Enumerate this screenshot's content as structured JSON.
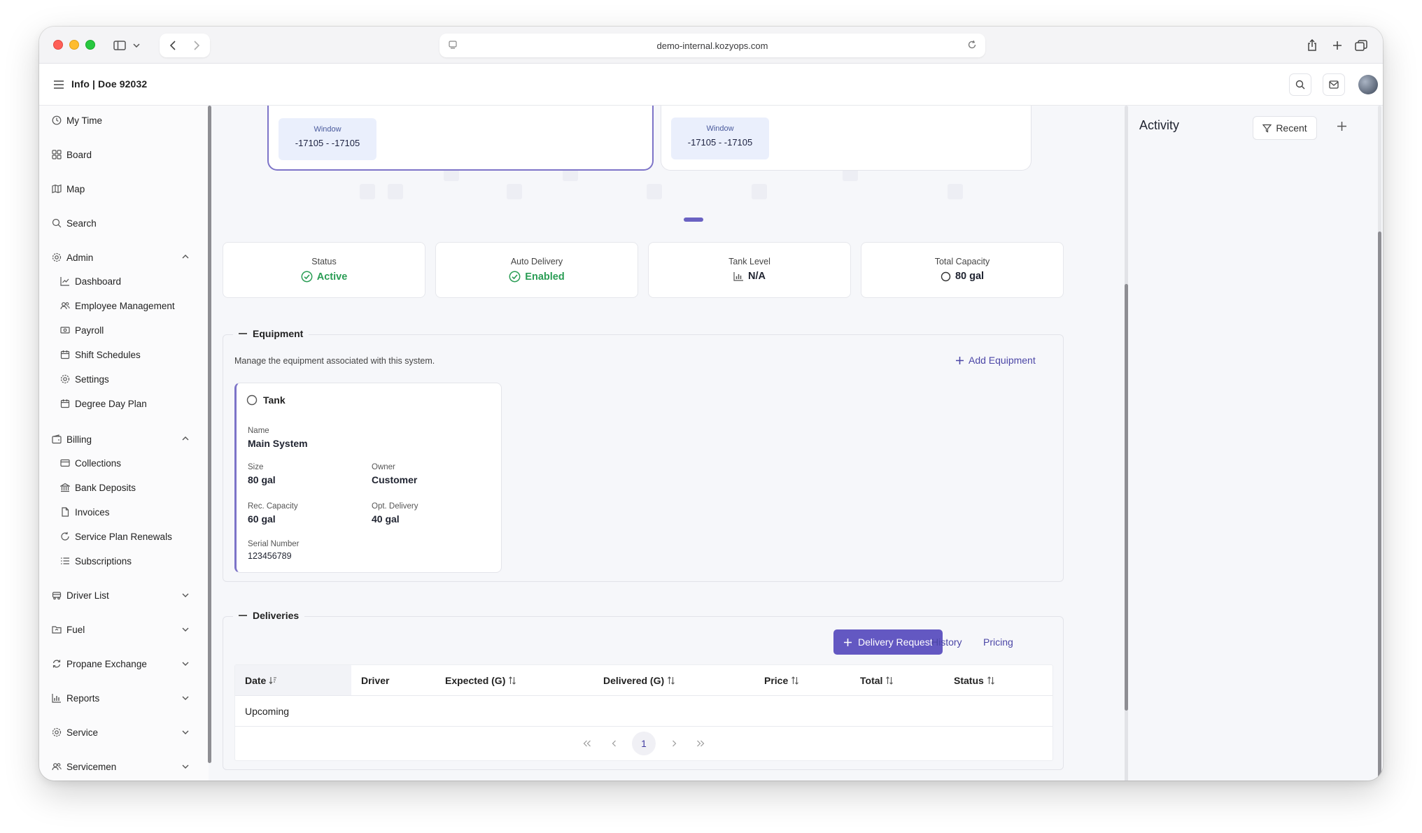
{
  "browser": {
    "url": "demo-internal.kozyops.com"
  },
  "header": {
    "title": "Info | Doe 92032"
  },
  "sidebar": {
    "items": [
      {
        "label": "My Time",
        "icon": "clock-icon"
      },
      {
        "label": "Board",
        "icon": "grid-icon"
      },
      {
        "label": "Map",
        "icon": "map-icon"
      },
      {
        "label": "Search",
        "icon": "search-icon"
      }
    ],
    "admin": {
      "label": "Admin",
      "children": [
        "Dashboard",
        "Employee Management",
        "Payroll",
        "Shift Schedules",
        "Settings",
        "Degree Day Plan"
      ]
    },
    "billing": {
      "label": "Billing",
      "children": [
        "Collections",
        "Bank Deposits",
        "Invoices",
        "Service Plan Renewals",
        "Subscriptions"
      ]
    },
    "collapsed": [
      "Driver List",
      "Fuel",
      "Propane Exchange",
      "Reports",
      "Service",
      "Servicemen"
    ]
  },
  "carousel": {
    "cards": [
      {
        "window_label": "Window",
        "window_value": "-17105 - -17105"
      },
      {
        "window_label": "Window",
        "window_value": "-17105 - -17105"
      }
    ]
  },
  "stats": [
    {
      "label": "Status",
      "value": "Active",
      "icon": "check-circle-icon",
      "color": "#2a9d55"
    },
    {
      "label": "Auto Delivery",
      "value": "Enabled",
      "icon": "check-circle-icon",
      "color": "#2a9d55"
    },
    {
      "label": "Tank Level",
      "value": "N/A",
      "icon": "bar-chart-icon",
      "color": "#1f2330"
    },
    {
      "label": "Total Capacity",
      "value": "80 gal",
      "icon": "circle-icon",
      "color": "#1f2330"
    }
  ],
  "equipment": {
    "title": "Equipment",
    "description": "Manage the equipment associated with this system.",
    "add_label": "Add Equipment",
    "tank": {
      "title": "Tank",
      "name_label": "Name",
      "name": "Main System",
      "size_label": "Size",
      "size": "80 gal",
      "owner_label": "Owner",
      "owner": "Customer",
      "rec_label": "Rec. Capacity",
      "rec": "60 gal",
      "opt_label": "Opt. Delivery",
      "opt": "40 gal",
      "serial_label": "Serial Number",
      "serial": "123456789"
    }
  },
  "deliveries": {
    "title": "Deliveries",
    "request_label": "Delivery Request",
    "history_label": "History",
    "pricing_label": "Pricing",
    "columns": [
      "Date",
      "Driver",
      "Expected (G)",
      "Delivered (G)",
      "Price",
      "Total",
      "Status"
    ],
    "rows": [
      "Upcoming"
    ],
    "pagination": {
      "current": "1"
    }
  },
  "activity": {
    "title": "Activity",
    "filter_label": "Recent"
  },
  "colors": {
    "accent": "#6358c2",
    "success": "#2a9d55"
  }
}
